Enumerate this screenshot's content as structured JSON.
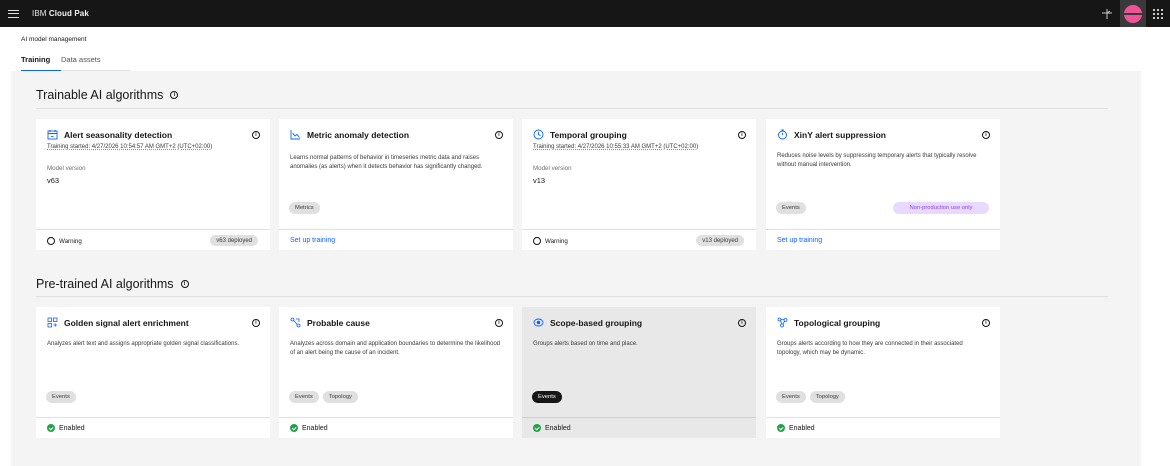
{
  "header": {
    "brand_prefix": "IBM",
    "brand_name": "Cloud Pak",
    "avatar_color": "#ee5396"
  },
  "breadcrumb": "AI model management",
  "tabs": [
    {
      "label": "Training",
      "active": true
    },
    {
      "label": "Data assets",
      "active": false
    }
  ],
  "sections": {
    "trainable_title": "Trainable AI algorithms",
    "pretrained_title": "Pre-trained AI algorithms"
  },
  "trainable": [
    {
      "title": "Alert seasonality detection",
      "icon": "calendar-icon",
      "training_started": "Training started: 4/27/2026 10:54:57 AM GMT+2 (UTC+02:00)",
      "model_version_label": "Model version",
      "model_version": "v63",
      "status": "Warning",
      "deployed": "v63 deployed"
    },
    {
      "title": "Metric anomaly detection",
      "icon": "chart-anomaly-icon",
      "description": "Learns normal patterns of behavior in timeseries metric data and raises anomalies (as alerts) when it detects behavior has significantly changed.",
      "tags": [
        "Metrics"
      ],
      "footer_link": "Set up training"
    },
    {
      "title": "Temporal grouping",
      "icon": "clock-icon",
      "training_started": "Training started: 4/27/2026 10:55:33 AM GMT+2 (UTC+02:00)",
      "model_version_label": "Model version",
      "model_version": "v13",
      "status": "Warning",
      "deployed": "v13 deployed"
    },
    {
      "title": "XinY alert suppression",
      "icon": "timer-icon",
      "description": "Reduces noise levels by suppressing temporary alerts that typically resolve without manual intervention.",
      "tags": [
        "Events"
      ],
      "special_tag": "Non-production use only",
      "footer_link": "Set up training"
    }
  ],
  "pretrained": [
    {
      "title": "Golden signal alert enrichment",
      "icon": "data-enrichment-icon",
      "description": "Analyzes alert text and assigns appropriate golden signal classifications.",
      "tags": [
        "Events"
      ],
      "status": "Enabled"
    },
    {
      "title": "Probable cause",
      "icon": "flow-icon",
      "description": "Analyzes across domain and application boundaries to determine the likelihood of an alert being the cause of an incident.",
      "tags": [
        "Events",
        "Topology"
      ],
      "status": "Enabled"
    },
    {
      "title": "Scope-based grouping",
      "icon": "scope-icon",
      "description": "Groups alerts based on time and place.",
      "tags": [
        "Events"
      ],
      "status": "Enabled"
    },
    {
      "title": "Topological grouping",
      "icon": "topology-icon",
      "description": "Groups alerts according to how they are connected in their associated topology, which may be dynamic.",
      "tags": [
        "Events",
        "Topology"
      ],
      "status": "Enabled"
    }
  ],
  "colors": {
    "accent": "#0f62fe",
    "success": "#24a148",
    "tag_special_bg": "#e8daff",
    "tag_special_fg": "#8a3ffc"
  }
}
